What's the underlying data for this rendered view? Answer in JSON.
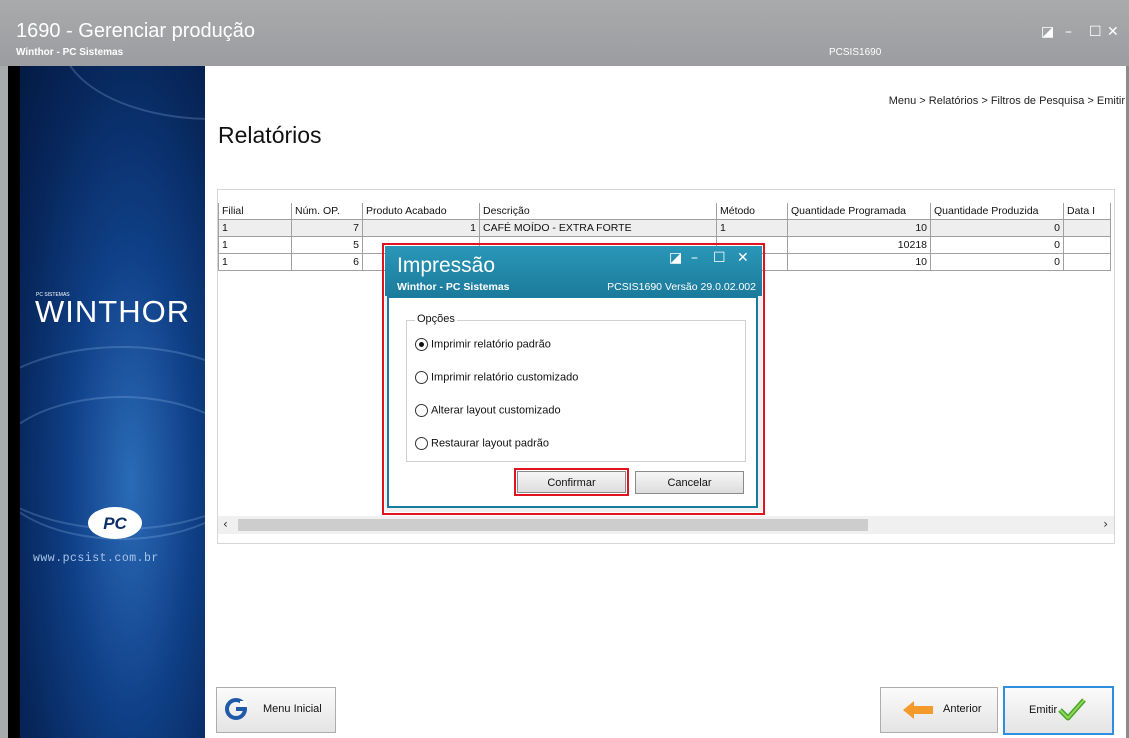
{
  "window": {
    "title": "1690 - Gerenciar produção",
    "subtitle": "Winthor - PC Sistemas",
    "code": "PCSIS1690"
  },
  "sidebar": {
    "brand_small": "PC SISTEMAS",
    "brand": "WINTHOR",
    "website": "www.pcsist.com.br"
  },
  "breadcrumb": "Menu > Relatórios > Filtros de Pesquisa > Emitir",
  "page_title": "Relatórios",
  "grid": {
    "columns": [
      "Filial",
      "Núm. OP.",
      "Produto Acabado",
      "Descrição",
      "Método",
      "Quantidade Programada",
      "Quantidade Produzida",
      "Data I"
    ],
    "rows": [
      {
        "filial": "1",
        "num_op": "7",
        "produto": "1",
        "descricao": "CAFÉ MOÍDO - EXTRA FORTE",
        "metodo": "1",
        "qtd_prog": "10",
        "qtd_prod": "0"
      },
      {
        "filial": "1",
        "num_op": "5",
        "produto": "",
        "descricao": "",
        "metodo": "",
        "qtd_prog": "10218",
        "qtd_prod": "0"
      },
      {
        "filial": "1",
        "num_op": "6",
        "produto": "",
        "descricao": "",
        "metodo": "",
        "qtd_prog": "10",
        "qtd_prod": "0"
      }
    ]
  },
  "dialog": {
    "title": "Impressão",
    "subtitle": "Winthor - PC Sistemas",
    "version": "PCSIS1690  Versão  29.0.02.002",
    "group_label": "Opções",
    "options": [
      {
        "label": "Imprimir relatório padrão",
        "selected": true
      },
      {
        "label": "Imprimir relatório customizado",
        "selected": false
      },
      {
        "label": "Alterar layout customizado",
        "selected": false
      },
      {
        "label": "Restaurar layout padrão",
        "selected": false
      }
    ],
    "confirm_label": "Confirmar",
    "cancel_label": "Cancelar"
  },
  "footer": {
    "menu_inicial": "Menu Inicial",
    "anterior": "Anterior",
    "emitir": "Emitir"
  },
  "colors": {
    "dialog_header": "#1c7b9c",
    "highlight": "#e0141e",
    "sidebar": "#0f3f86",
    "emit_border": "#2e8fdf"
  }
}
